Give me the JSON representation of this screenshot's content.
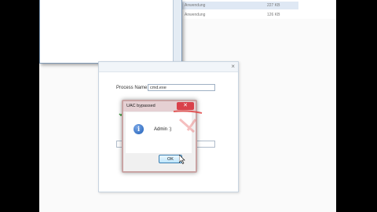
{
  "explorer": {
    "rows": [
      {
        "type": "Anwendung",
        "size": "227 KB",
        "selected": true
      },
      {
        "type": "Anwendung",
        "size": "126 KB",
        "selected": false
      }
    ]
  },
  "process_window": {
    "close_glyph": "×",
    "process_label": "Process Name:",
    "process_value": "cmd.exe"
  },
  "uac_dialog": {
    "title": "UAC bypassed",
    "close_glyph": "✕",
    "message": "Admin :)",
    "ok_label": "OK",
    "icon": "info-icon"
  },
  "colors": {
    "close_red": "#d9414b",
    "title_tint": "#e5d0d3",
    "info_blue": "#1f5fb8"
  }
}
